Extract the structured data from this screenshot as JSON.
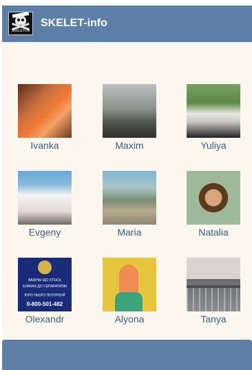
{
  "header": {
    "title": "SKELET-info",
    "logo_text": "SKELETON"
  },
  "profiles": [
    {
      "name": "Ivanka"
    },
    {
      "name": "Maxim"
    },
    {
      "name": "Yuliya"
    },
    {
      "name": "Evgeny"
    },
    {
      "name": "Maria"
    },
    {
      "name": "Natalia"
    },
    {
      "name": "Olexandr"
    },
    {
      "name": "Alyona"
    },
    {
      "name": "Tanya"
    }
  ],
  "photo7_text": {
    "line1": "ВАЖНЫ ЩО ХТОСЬ",
    "line2": "ЕЛИКАХ ДО СЕПАРАТИЗМ",
    "line3": "ЮРО НЬОГО ПОТУРБУЙ",
    "line4": "0-800-501-482"
  },
  "theme": {
    "header_bg": "#5d7ea6",
    "page_bg": "#fbf7ef",
    "link_color": "#385b84"
  }
}
